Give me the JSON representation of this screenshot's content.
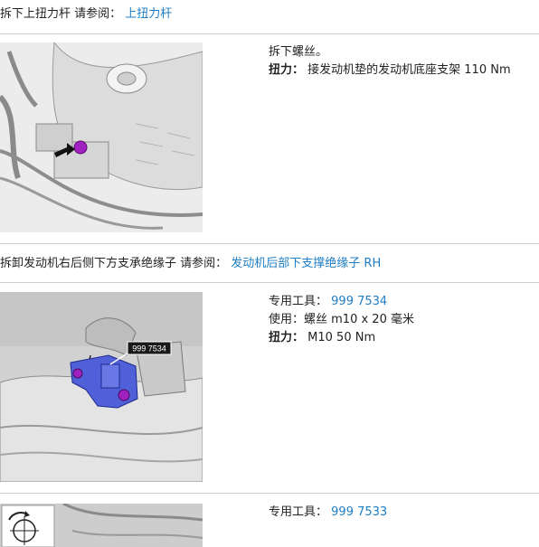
{
  "section1": {
    "header_text": "拆下上扭力杆 请参阅：",
    "header_link": "上扭力杆",
    "instruction": "拆下螺丝。",
    "torque_label": "扭力：",
    "torque_value": "接发动机垫的发动机底座支架 110 Nm"
  },
  "section2": {
    "header_text": "拆卸发动机右后侧下方支承绝缘子 请参阅：",
    "header_link": "发动机后部下支撑绝缘子 RH",
    "tool_label": "专用工具：",
    "tool_link": "999 7534",
    "use_text": "使用：螺丝 m10 x 20 毫米",
    "torque_label": "扭力：",
    "torque_value": "M10 50 Nm",
    "callout": "999 7534"
  },
  "section3": {
    "tool_label": "专用工具：",
    "tool_link": "999 7533"
  },
  "colors": {
    "link": "#1e7dc3",
    "highlight": "#a020c0",
    "tool": "#5060d8"
  }
}
